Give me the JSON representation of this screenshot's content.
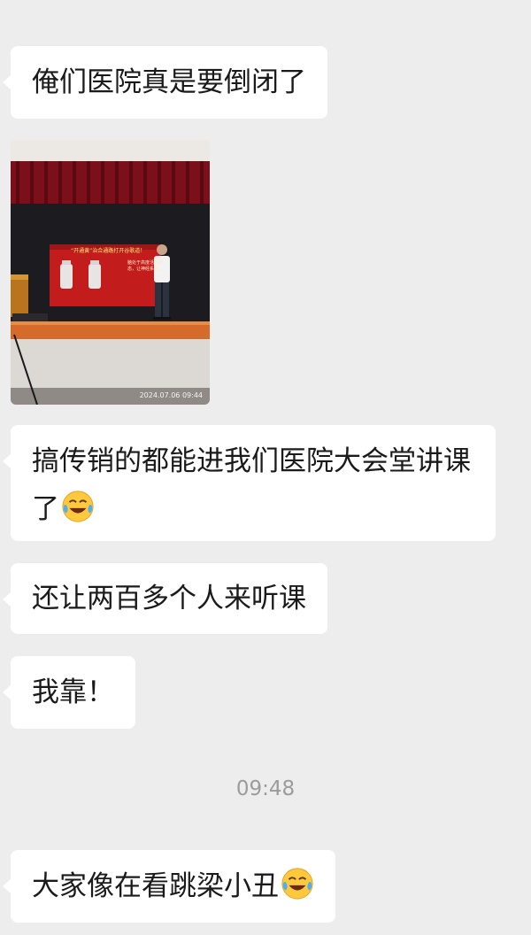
{
  "messages": [
    {
      "text": "俺们医院真是要倒闭了"
    },
    {
      "image": {
        "banner_title": "“开通黄”治合通路打开谷歌道！",
        "date_stamp": "2024.07.06  09:44",
        "side_text": "脑处于高度活跃状态，让神经系统..."
      }
    },
    {
      "text": "搞传销的都能进我们医院大会堂讲课了",
      "emoji": "face-with-tears-of-joy"
    },
    {
      "text": "还让两百多个人来听课"
    },
    {
      "text": "我靠！"
    },
    {
      "text": "大家像在看跳梁小丑",
      "emoji": "face-with-tears-of-joy"
    }
  ],
  "timestamp": "09:48",
  "colors": {
    "background": "#ededed",
    "bubble": "#ffffff",
    "text": "#1a1a1a",
    "timestamp": "#9b9b9b"
  }
}
